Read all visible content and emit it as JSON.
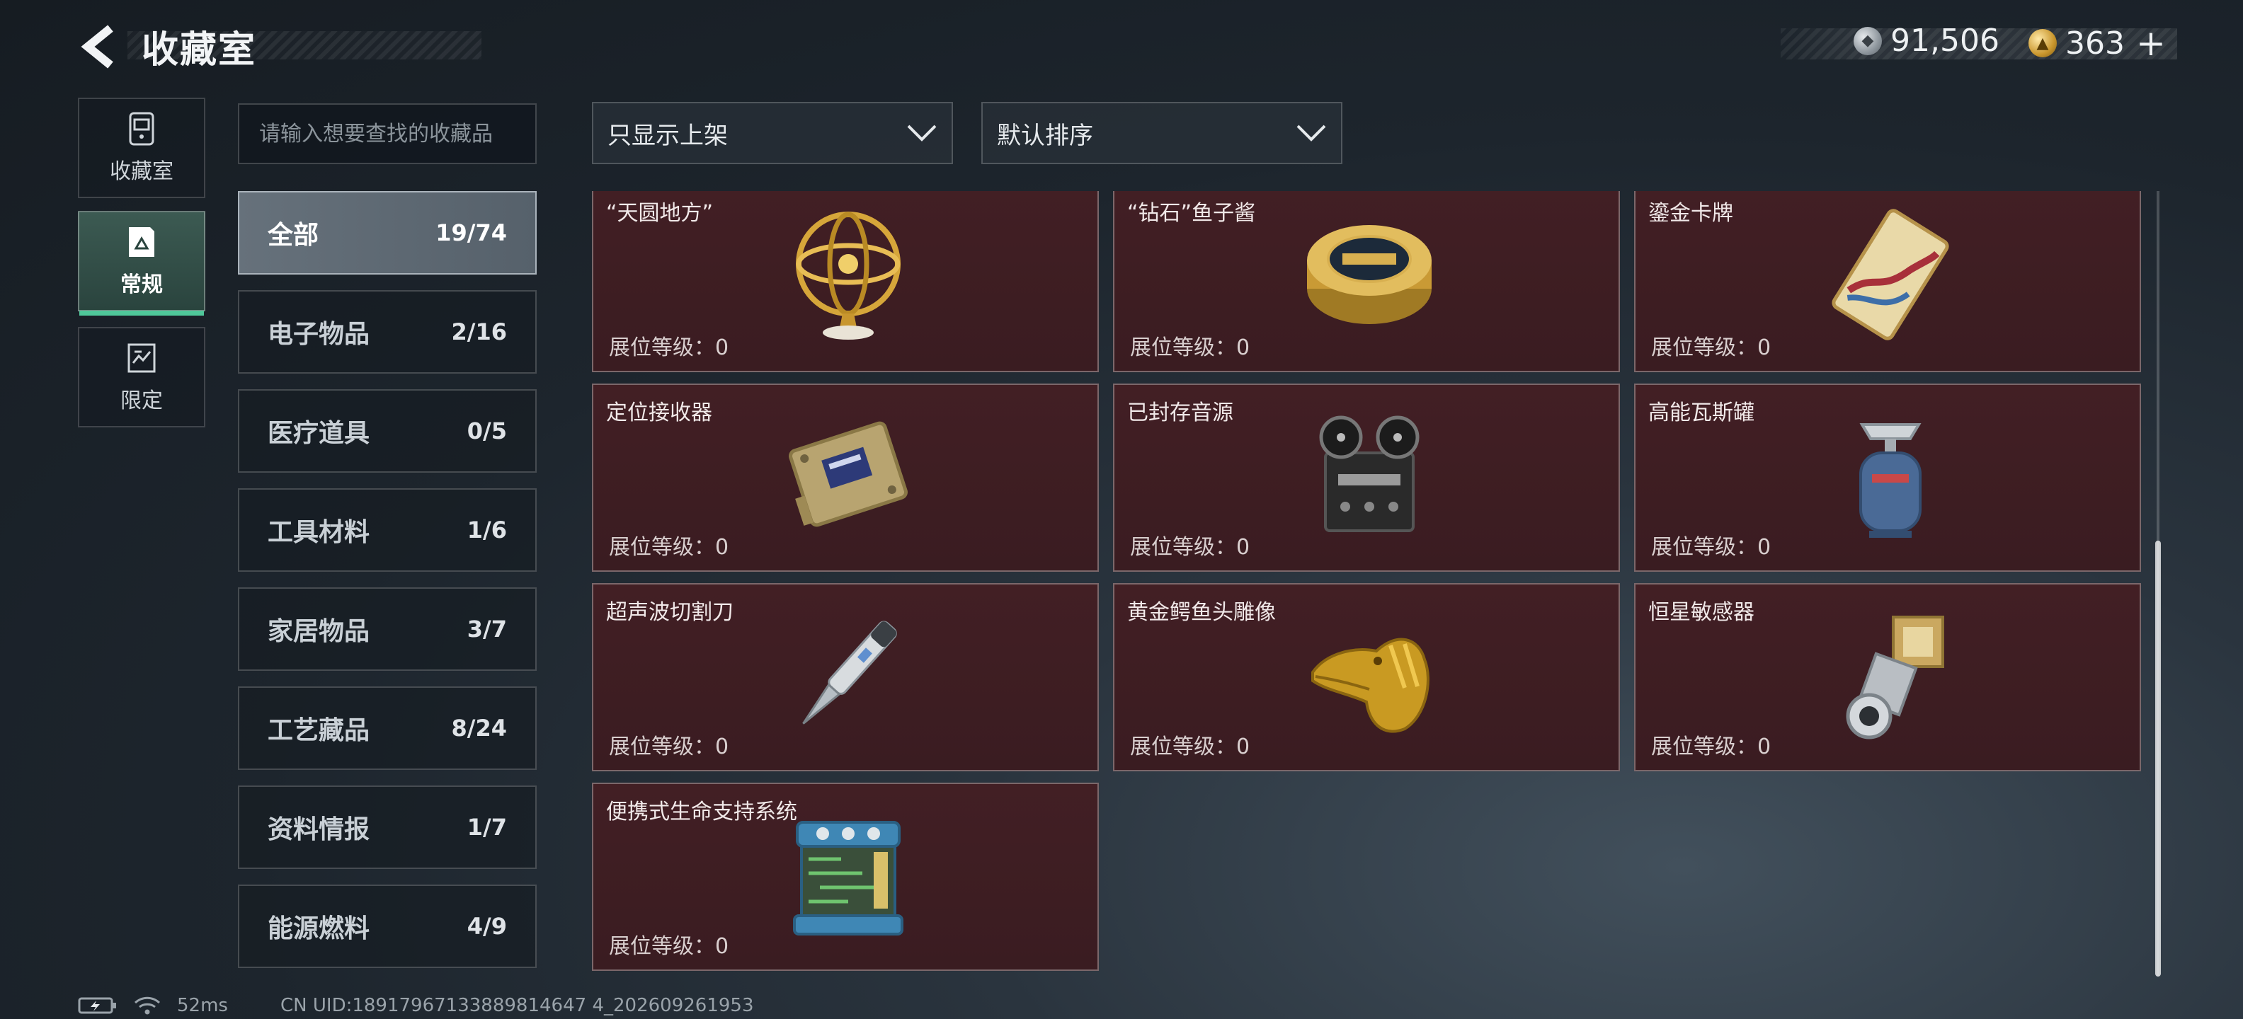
{
  "header": {
    "title": "收藏室"
  },
  "currency": {
    "silver_amount": "91,506",
    "gold_amount": "363"
  },
  "rail": [
    {
      "label": "收藏室",
      "icon": "collection-room-icon"
    },
    {
      "label": "常规",
      "icon": "regular-icon",
      "active": true
    },
    {
      "label": "限定",
      "icon": "limited-icon"
    }
  ],
  "search": {
    "placeholder": "请输入想要查找的收藏品",
    "value": ""
  },
  "filters": {
    "shelf_filter": "只显示上架",
    "sort_order": "默认排序"
  },
  "categories": [
    {
      "name": "全部",
      "count": "19/74",
      "active": true
    },
    {
      "name": "电子物品",
      "count": "2/16"
    },
    {
      "name": "医疗道具",
      "count": "0/5"
    },
    {
      "name": "工具材料",
      "count": "1/6"
    },
    {
      "name": "家居物品",
      "count": "3/7"
    },
    {
      "name": "工艺藏品",
      "count": "8/24"
    },
    {
      "name": "资料情报",
      "count": "1/7"
    },
    {
      "name": "能源燃料",
      "count": "4/9"
    }
  ],
  "items": [
    {
      "name": "“天圆地方”",
      "level": "展位等级：0",
      "icon": "armillary-sphere-icon"
    },
    {
      "name": "“钻石”鱼子酱",
      "level": "展位等级：0",
      "icon": "caviar-tin-icon"
    },
    {
      "name": "鎏金卡牌",
      "level": "展位等级：0",
      "icon": "gilded-card-icon"
    },
    {
      "name": "定位接收器",
      "level": "展位等级：0",
      "icon": "gps-receiver-icon"
    },
    {
      "name": "已封存音源",
      "level": "展位等级：0",
      "icon": "reel-tape-recorder-icon"
    },
    {
      "name": "高能瓦斯罐",
      "level": "展位等级：0",
      "icon": "gas-canister-icon"
    },
    {
      "name": "超声波切割刀",
      "level": "展位等级：0",
      "icon": "ultrasonic-cutter-icon"
    },
    {
      "name": "黄金鳄鱼头雕像",
      "level": "展位等级：0",
      "icon": "golden-crocodile-head-icon"
    },
    {
      "name": "恒星敏感器",
      "level": "展位等级：0",
      "icon": "star-sensor-icon"
    },
    {
      "name": "便携式生命支持系统",
      "level": "展位等级：0",
      "icon": "life-support-system-icon"
    }
  ],
  "footer": {
    "ping": "52ms",
    "uid": "CN UID:18917967133889814647 4_202609261953"
  },
  "colors": {
    "accent": "#4fc79a",
    "card_bg": "#421f24",
    "card_border": "#7b676a"
  }
}
